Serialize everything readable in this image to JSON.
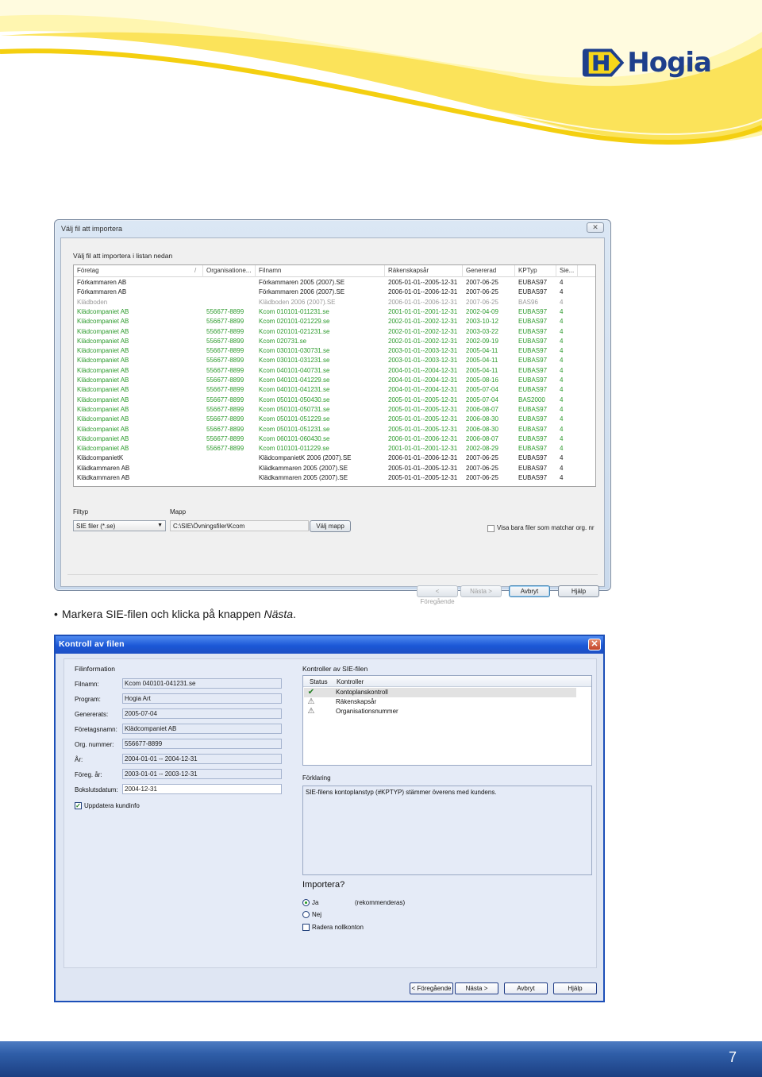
{
  "brand": {
    "name": "Hogia",
    "mark": "H",
    "primary_color": "#1e3f8c",
    "accent_color": "#f6d61a"
  },
  "window1": {
    "title": "Välj fil att importera",
    "close_glyph": "✕",
    "subtitle": "Välj fil att importera i listan nedan",
    "columns": [
      "Företag",
      "/",
      "Organisatione...",
      "Filnamn",
      "Räkenskapsår",
      "Genererad",
      "KPTyp",
      "Sie..."
    ],
    "rows": [
      {
        "style": "black",
        "cells": [
          "Förkammaren AB",
          "",
          "Förkammaren 2005 (2007).SE",
          "2005-01-01--2005-12-31",
          "2007-06-25",
          "EUBAS97",
          "4"
        ]
      },
      {
        "style": "black",
        "cells": [
          "Förkammaren AB",
          "",
          "Förkammaren 2006 (2007).SE",
          "2006-01-01--2006-12-31",
          "2007-06-25",
          "EUBAS97",
          "4"
        ]
      },
      {
        "style": "gray",
        "cells": [
          "Klädboden",
          "",
          "Klädboden 2006 (2007).SE",
          "2006-01-01--2006-12-31",
          "2007-06-25",
          "BAS96",
          "4"
        ]
      },
      {
        "style": "green",
        "cells": [
          "Klädcompaniet AB",
          "556677-8899",
          "Kcom 010101-011231.se",
          "2001-01-01--2001-12-31",
          "2002-04-09",
          "EUBAS97",
          "4"
        ]
      },
      {
        "style": "green",
        "cells": [
          "Klädcompaniet AB",
          "556677-8899",
          "Kcom 020101-021229.se",
          "2002-01-01--2002-12-31",
          "2003-10-12",
          "EUBAS97",
          "4"
        ]
      },
      {
        "style": "green",
        "cells": [
          "Klädcompaniet AB",
          "556677-8899",
          "Kcom 020101-021231.se",
          "2002-01-01--2002-12-31",
          "2003-03-22",
          "EUBAS97",
          "4"
        ]
      },
      {
        "style": "green",
        "cells": [
          "Klädcompaniet AB",
          "556677-8899",
          "Kcom 020731.se",
          "2002-01-01--2002-12-31",
          "2002-09-19",
          "EUBAS97",
          "4"
        ]
      },
      {
        "style": "green",
        "cells": [
          "Klädcompaniet AB",
          "556677-8899",
          "Kcom 030101-030731.se",
          "2003-01-01--2003-12-31",
          "2005-04-11",
          "EUBAS97",
          "4"
        ]
      },
      {
        "style": "green",
        "cells": [
          "Klädcompaniet AB",
          "556677-8899",
          "Kcom 030101-031231.se",
          "2003-01-01--2003-12-31",
          "2005-04-11",
          "EUBAS97",
          "4"
        ]
      },
      {
        "style": "green",
        "cells": [
          "Klädcompaniet AB",
          "556677-8899",
          "Kcom 040101-040731.se",
          "2004-01-01--2004-12-31",
          "2005-04-11",
          "EUBAS97",
          "4"
        ]
      },
      {
        "style": "green",
        "cells": [
          "Klädcompaniet AB",
          "556677-8899",
          "Kcom 040101-041229.se",
          "2004-01-01--2004-12-31",
          "2005-08-16",
          "EUBAS97",
          "4"
        ]
      },
      {
        "style": "green",
        "cells": [
          "Klädcompaniet AB",
          "556677-8899",
          "Kcom 040101-041231.se",
          "2004-01-01--2004-12-31",
          "2005-07-04",
          "EUBAS97",
          "4"
        ]
      },
      {
        "style": "green",
        "cells": [
          "Klädcompaniet AB",
          "556677-8899",
          "Kcom 050101-050430.se",
          "2005-01-01--2005-12-31",
          "2005-07-04",
          "BAS2000",
          "4"
        ]
      },
      {
        "style": "green",
        "cells": [
          "Klädcompaniet AB",
          "556677-8899",
          "Kcom 050101-050731.se",
          "2005-01-01--2005-12-31",
          "2006-08-07",
          "EUBAS97",
          "4"
        ]
      },
      {
        "style": "green",
        "cells": [
          "Klädcompaniet AB",
          "556677-8899",
          "Kcom 050101-051229.se",
          "2005-01-01--2005-12-31",
          "2006-08-30",
          "EUBAS97",
          "4"
        ]
      },
      {
        "style": "green",
        "cells": [
          "Klädcompaniet AB",
          "556677-8899",
          "Kcom 050101-051231.se",
          "2005-01-01--2005-12-31",
          "2006-08-30",
          "EUBAS97",
          "4"
        ]
      },
      {
        "style": "green",
        "cells": [
          "Klädcompaniet AB",
          "556677-8899",
          "Kcom 060101-060430.se",
          "2006-01-01--2006-12-31",
          "2006-08-07",
          "EUBAS97",
          "4"
        ]
      },
      {
        "style": "green",
        "cells": [
          "Klädcompaniet AB",
          "556677-8899",
          "Kcom 010101-011229.se",
          "2001-01-01--2001-12-31",
          "2002-08-29",
          "EUBAS97",
          "4"
        ]
      },
      {
        "style": "black",
        "cells": [
          "KlädcompanietK",
          "",
          "KlädcompanietK 2006 (2007).SE",
          "2006-01-01--2006-12-31",
          "2007-06-25",
          "EUBAS97",
          "4"
        ]
      },
      {
        "style": "black",
        "cells": [
          "Klädkammaren AB",
          "",
          "Klädkammaren 2005 (2007).SE",
          "2005-01-01--2005-12-31",
          "2007-06-25",
          "EUBAS97",
          "4"
        ]
      },
      {
        "style": "black",
        "cells": [
          "Klädkammaren AB",
          "",
          "Klädkammaren 2005 (2007).SE",
          "2005-01-01--2005-12-31",
          "2007-06-25",
          "EUBAS97",
          "4"
        ]
      }
    ],
    "filetype_label": "Filtyp",
    "filetype_value": "SIE filer (*.se)",
    "folder_label": "Mapp",
    "folder_value": "C:\\SIE\\Övningsfiler\\Kcom",
    "choose_folder_button": "Välj mapp",
    "match_checkbox_label": "Visa bara filer som matchar org. nr",
    "buttons": {
      "back": "< Föregående",
      "next": "Nästa >",
      "cancel": "Avbryt",
      "help": "Hjälp"
    }
  },
  "instruction": {
    "prefix": "Markera SIE-filen och klicka på knappen ",
    "emphasis": "Nästa",
    "suffix": "."
  },
  "window2": {
    "title": "Kontroll av filen",
    "close_glyph": "✕",
    "fileinfo_title": "Filinformation",
    "fields": [
      {
        "label": "Filnamn:",
        "value": "Kcom 040101-041231.se"
      },
      {
        "label": "Program:",
        "value": "Hogia Art"
      },
      {
        "label": "Genererats:",
        "value": "2005-07-04"
      },
      {
        "label": "Företagsnamn:",
        "value": "Klädcompaniet AB"
      },
      {
        "label": "Org. nummer:",
        "value": "556677-8899"
      },
      {
        "label": "År:",
        "value": "2004-01-01 -- 2004-12-31"
      },
      {
        "label": "Föreg. år:",
        "value": "2003-01-01 -- 2003-12-31"
      },
      {
        "label": "Bokslutsdatum:",
        "value": "2004-12-31"
      }
    ],
    "update_checkbox_label": "Uppdatera kundinfo",
    "checks_title": "Kontroller av SIE-filen",
    "checks_columns": [
      "Status",
      "Kontroller"
    ],
    "checks": [
      {
        "icon": "checkmark-icon",
        "glyph": "✔",
        "label": "Kontoplanskontroll"
      },
      {
        "icon": "warning-icon",
        "glyph": "⚠",
        "label": "Räkenskapsår"
      },
      {
        "icon": "warning-icon",
        "glyph": "⚠",
        "label": "Organisationsnummer"
      }
    ],
    "explanation_title": "Förklaring",
    "explanation_text": "SIE-filens kontoplanstyp (#KPTYP) stämmer överens med kundens.",
    "import_title": "Importera?",
    "options": {
      "yes": "Ja",
      "recommended": "(rekommenderas)",
      "no": "Nej",
      "zero_accounts": "Radera nollkonton"
    },
    "buttons": {
      "back": "< Föregående",
      "next": "Nästa >",
      "cancel": "Avbryt",
      "help": "Hjälp"
    }
  },
  "page_number": "7"
}
